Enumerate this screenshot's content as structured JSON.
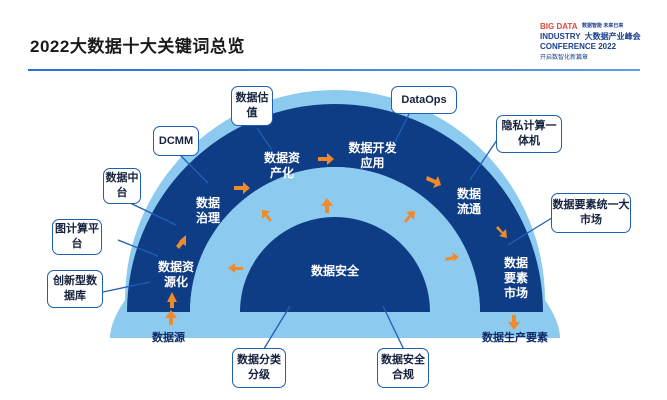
{
  "title": "2022大数据十大关键词总览",
  "logo": {
    "line1": "BIG DATA",
    "line2": "INDUSTRY",
    "line3": "CONFERENCE 2022",
    "cn": "大数据产业峰会",
    "sub": "开启数智化新篇章",
    "tag": "数据智能 未来已来",
    "brand_red": "#e0463a",
    "brand_blue": "#1a3f8f"
  },
  "colors": {
    "outer_ring": "#0e3d86",
    "middle_ring": "#8ccaf0",
    "inner_core": "#0e3d86",
    "outer_base": "#8ccaf0",
    "arrow": "#f08a2a",
    "box_border": "#1f5fb5"
  },
  "core": "数据安全",
  "stages": {
    "s1": "数据资源化",
    "s2": "数据治理",
    "s3": "数据资产化",
    "s4": "数据开发应用",
    "s5": "数据流通",
    "s6": "数据要素市场"
  },
  "ends": {
    "source": "数据源",
    "output": "数据生产要素"
  },
  "keywords": {
    "k1": "创新型数据库",
    "k2": "图计算平台",
    "k3": "数据中台",
    "k4": "DCMM",
    "k5": "数据估值",
    "k6": "DataOps",
    "k7": "隐私计算一体机",
    "k8": "数据要素统一大市场",
    "k9": "数据分类分级",
    "k10": "数据安全合规"
  }
}
